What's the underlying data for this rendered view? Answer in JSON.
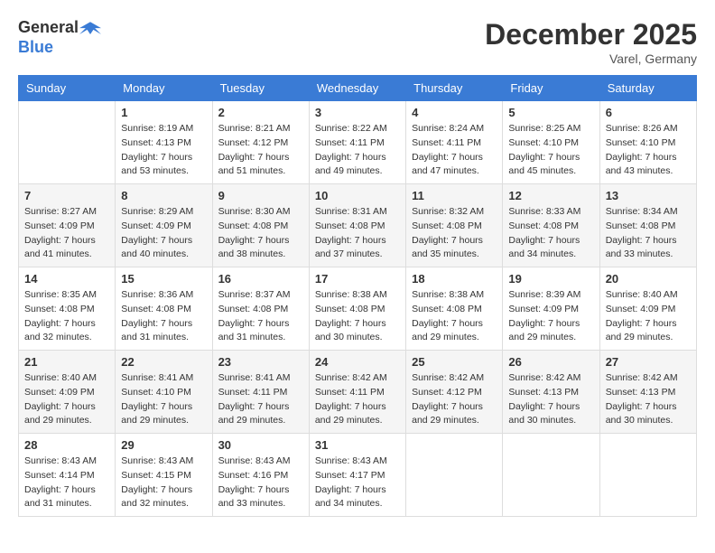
{
  "header": {
    "logo_general": "General",
    "logo_blue": "Blue",
    "month_title": "December 2025",
    "location": "Varel, Germany"
  },
  "weekdays": [
    "Sunday",
    "Monday",
    "Tuesday",
    "Wednesday",
    "Thursday",
    "Friday",
    "Saturday"
  ],
  "weeks": [
    [
      {
        "day": "",
        "sunrise": "",
        "sunset": "",
        "daylight": ""
      },
      {
        "day": "1",
        "sunrise": "Sunrise: 8:19 AM",
        "sunset": "Sunset: 4:13 PM",
        "daylight": "Daylight: 7 hours and 53 minutes."
      },
      {
        "day": "2",
        "sunrise": "Sunrise: 8:21 AM",
        "sunset": "Sunset: 4:12 PM",
        "daylight": "Daylight: 7 hours and 51 minutes."
      },
      {
        "day": "3",
        "sunrise": "Sunrise: 8:22 AM",
        "sunset": "Sunset: 4:11 PM",
        "daylight": "Daylight: 7 hours and 49 minutes."
      },
      {
        "day": "4",
        "sunrise": "Sunrise: 8:24 AM",
        "sunset": "Sunset: 4:11 PM",
        "daylight": "Daylight: 7 hours and 47 minutes."
      },
      {
        "day": "5",
        "sunrise": "Sunrise: 8:25 AM",
        "sunset": "Sunset: 4:10 PM",
        "daylight": "Daylight: 7 hours and 45 minutes."
      },
      {
        "day": "6",
        "sunrise": "Sunrise: 8:26 AM",
        "sunset": "Sunset: 4:10 PM",
        "daylight": "Daylight: 7 hours and 43 minutes."
      }
    ],
    [
      {
        "day": "7",
        "sunrise": "Sunrise: 8:27 AM",
        "sunset": "Sunset: 4:09 PM",
        "daylight": "Daylight: 7 hours and 41 minutes."
      },
      {
        "day": "8",
        "sunrise": "Sunrise: 8:29 AM",
        "sunset": "Sunset: 4:09 PM",
        "daylight": "Daylight: 7 hours and 40 minutes."
      },
      {
        "day": "9",
        "sunrise": "Sunrise: 8:30 AM",
        "sunset": "Sunset: 4:08 PM",
        "daylight": "Daylight: 7 hours and 38 minutes."
      },
      {
        "day": "10",
        "sunrise": "Sunrise: 8:31 AM",
        "sunset": "Sunset: 4:08 PM",
        "daylight": "Daylight: 7 hours and 37 minutes."
      },
      {
        "day": "11",
        "sunrise": "Sunrise: 8:32 AM",
        "sunset": "Sunset: 4:08 PM",
        "daylight": "Daylight: 7 hours and 35 minutes."
      },
      {
        "day": "12",
        "sunrise": "Sunrise: 8:33 AM",
        "sunset": "Sunset: 4:08 PM",
        "daylight": "Daylight: 7 hours and 34 minutes."
      },
      {
        "day": "13",
        "sunrise": "Sunrise: 8:34 AM",
        "sunset": "Sunset: 4:08 PM",
        "daylight": "Daylight: 7 hours and 33 minutes."
      }
    ],
    [
      {
        "day": "14",
        "sunrise": "Sunrise: 8:35 AM",
        "sunset": "Sunset: 4:08 PM",
        "daylight": "Daylight: 7 hours and 32 minutes."
      },
      {
        "day": "15",
        "sunrise": "Sunrise: 8:36 AM",
        "sunset": "Sunset: 4:08 PM",
        "daylight": "Daylight: 7 hours and 31 minutes."
      },
      {
        "day": "16",
        "sunrise": "Sunrise: 8:37 AM",
        "sunset": "Sunset: 4:08 PM",
        "daylight": "Daylight: 7 hours and 31 minutes."
      },
      {
        "day": "17",
        "sunrise": "Sunrise: 8:38 AM",
        "sunset": "Sunset: 4:08 PM",
        "daylight": "Daylight: 7 hours and 30 minutes."
      },
      {
        "day": "18",
        "sunrise": "Sunrise: 8:38 AM",
        "sunset": "Sunset: 4:08 PM",
        "daylight": "Daylight: 7 hours and 29 minutes."
      },
      {
        "day": "19",
        "sunrise": "Sunrise: 8:39 AM",
        "sunset": "Sunset: 4:09 PM",
        "daylight": "Daylight: 7 hours and 29 minutes."
      },
      {
        "day": "20",
        "sunrise": "Sunrise: 8:40 AM",
        "sunset": "Sunset: 4:09 PM",
        "daylight": "Daylight: 7 hours and 29 minutes."
      }
    ],
    [
      {
        "day": "21",
        "sunrise": "Sunrise: 8:40 AM",
        "sunset": "Sunset: 4:09 PM",
        "daylight": "Daylight: 7 hours and 29 minutes."
      },
      {
        "day": "22",
        "sunrise": "Sunrise: 8:41 AM",
        "sunset": "Sunset: 4:10 PM",
        "daylight": "Daylight: 7 hours and 29 minutes."
      },
      {
        "day": "23",
        "sunrise": "Sunrise: 8:41 AM",
        "sunset": "Sunset: 4:11 PM",
        "daylight": "Daylight: 7 hours and 29 minutes."
      },
      {
        "day": "24",
        "sunrise": "Sunrise: 8:42 AM",
        "sunset": "Sunset: 4:11 PM",
        "daylight": "Daylight: 7 hours and 29 minutes."
      },
      {
        "day": "25",
        "sunrise": "Sunrise: 8:42 AM",
        "sunset": "Sunset: 4:12 PM",
        "daylight": "Daylight: 7 hours and 29 minutes."
      },
      {
        "day": "26",
        "sunrise": "Sunrise: 8:42 AM",
        "sunset": "Sunset: 4:13 PM",
        "daylight": "Daylight: 7 hours and 30 minutes."
      },
      {
        "day": "27",
        "sunrise": "Sunrise: 8:42 AM",
        "sunset": "Sunset: 4:13 PM",
        "daylight": "Daylight: 7 hours and 30 minutes."
      }
    ],
    [
      {
        "day": "28",
        "sunrise": "Sunrise: 8:43 AM",
        "sunset": "Sunset: 4:14 PM",
        "daylight": "Daylight: 7 hours and 31 minutes."
      },
      {
        "day": "29",
        "sunrise": "Sunrise: 8:43 AM",
        "sunset": "Sunset: 4:15 PM",
        "daylight": "Daylight: 7 hours and 32 minutes."
      },
      {
        "day": "30",
        "sunrise": "Sunrise: 8:43 AM",
        "sunset": "Sunset: 4:16 PM",
        "daylight": "Daylight: 7 hours and 33 minutes."
      },
      {
        "day": "31",
        "sunrise": "Sunrise: 8:43 AM",
        "sunset": "Sunset: 4:17 PM",
        "daylight": "Daylight: 7 hours and 34 minutes."
      },
      {
        "day": "",
        "sunrise": "",
        "sunset": "",
        "daylight": ""
      },
      {
        "day": "",
        "sunrise": "",
        "sunset": "",
        "daylight": ""
      },
      {
        "day": "",
        "sunrise": "",
        "sunset": "",
        "daylight": ""
      }
    ]
  ]
}
